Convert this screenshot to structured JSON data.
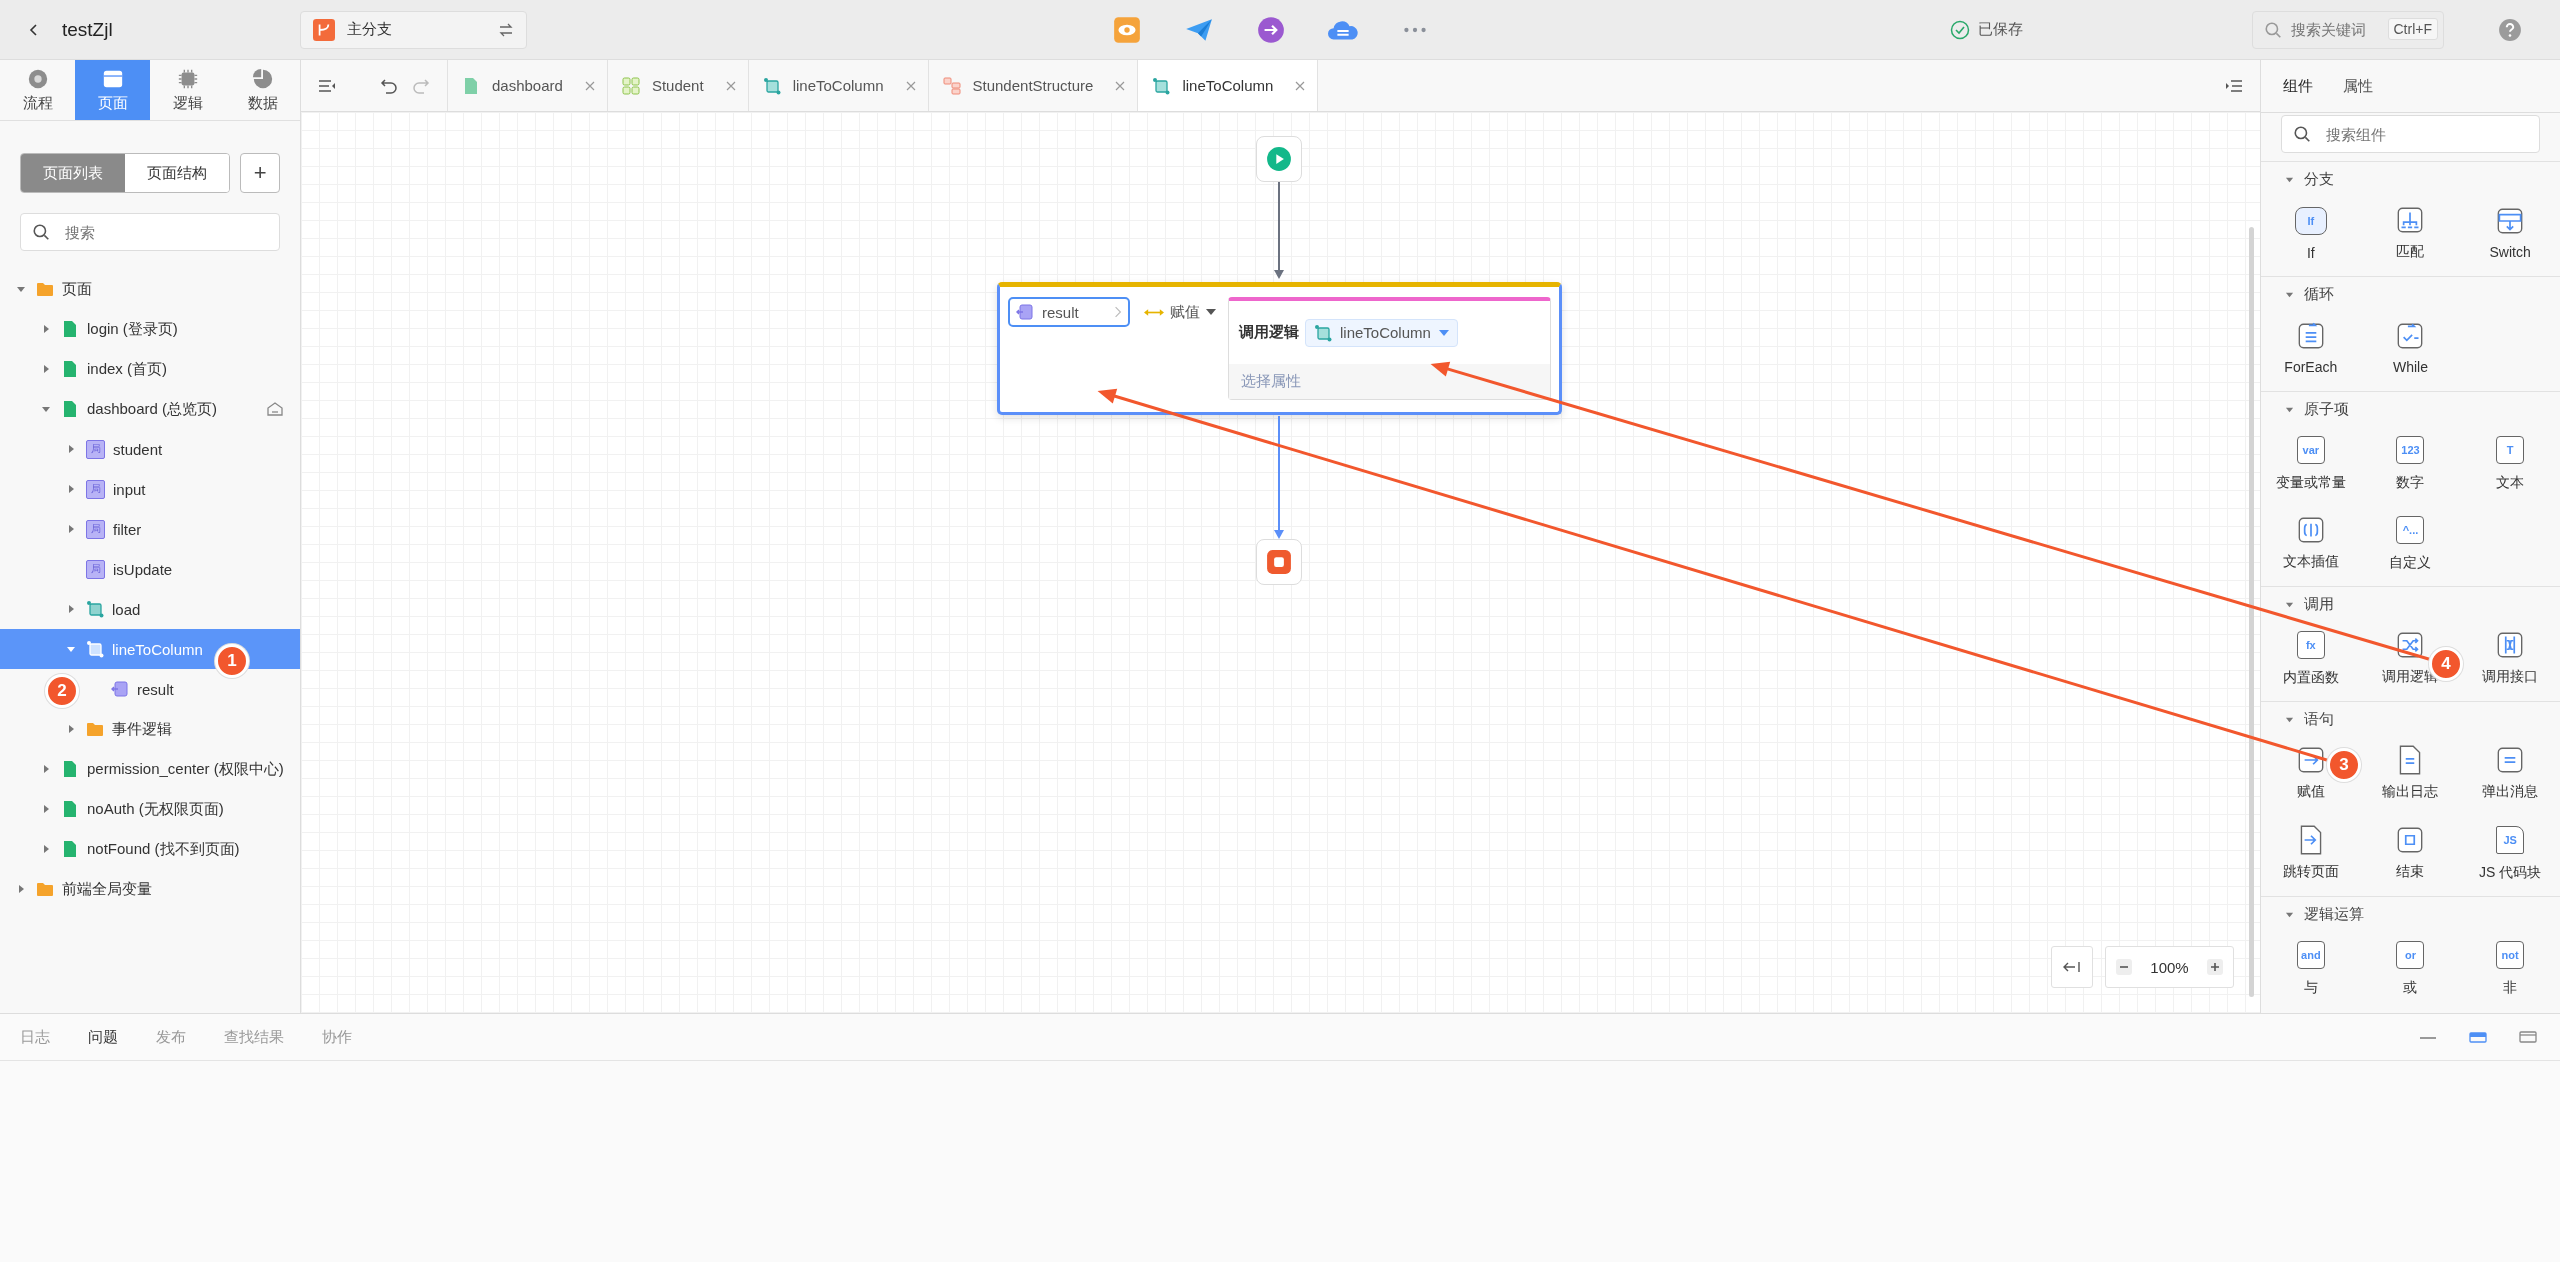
{
  "header": {
    "title": "testZjl",
    "branch": "主分支",
    "status": "已保存",
    "search": {
      "placeholder": "搜索关键词",
      "shortcut": "Ctrl+F"
    }
  },
  "rail_tabs": [
    {
      "label": "流程",
      "kind": "disc",
      "selected": false
    },
    {
      "label": "页面",
      "kind": "window",
      "selected": true
    },
    {
      "label": "逻辑",
      "kind": "chip",
      "selected": false
    },
    {
      "label": "数据",
      "kind": "pie",
      "selected": false
    }
  ],
  "view_switch": [
    {
      "label": "页面列表",
      "selected": true
    },
    {
      "label": "页面结构",
      "selected": false
    }
  ],
  "add_button": "+",
  "tree_search": {
    "placeholder": "搜索"
  },
  "tree": [
    {
      "label": "页面",
      "kind": "folder",
      "expanded": true,
      "selected": false,
      "children": [
        {
          "label": "login (登录页)",
          "kind": "page",
          "expanded": false,
          "selected": false
        },
        {
          "label": "index (首页)",
          "kind": "page",
          "expanded": false,
          "selected": false
        },
        {
          "label": "dashboard (总览页)",
          "kind": "page",
          "expanded": true,
          "selected": false,
          "home": true,
          "children": [
            {
              "label": "student",
              "kind": "variable",
              "tag": "局",
              "expanded": false,
              "selected": false
            },
            {
              "label": "input",
              "kind": "variable",
              "tag": "局",
              "expanded": false,
              "selected": false
            },
            {
              "label": "filter",
              "kind": "variable",
              "tag": "局",
              "expanded": false,
              "selected": false
            },
            {
              "label": "isUpdate",
              "kind": "variable",
              "tag": "局",
              "selected": false
            },
            {
              "label": "load",
              "kind": "logic",
              "expanded": false,
              "selected": false
            },
            {
              "label": "lineToColumn",
              "kind": "logic",
              "expanded": true,
              "selected": true,
              "children": [
                {
                  "label": "result",
                  "kind": "output",
                  "selected": false
                }
              ]
            },
            {
              "label": "事件逻辑",
              "kind": "folder",
              "expanded": false,
              "selected": false
            }
          ]
        },
        {
          "label": "permission_center (权限中心)",
          "kind": "page",
          "expanded": false,
          "selected": false
        },
        {
          "label": "noAuth (无权限页面)",
          "kind": "page",
          "expanded": false,
          "selected": false
        },
        {
          "label": "notFound (找不到页面)",
          "kind": "page",
          "expanded": false,
          "selected": false
        }
      ]
    },
    {
      "label": "前端全局变量",
      "kind": "folder",
      "expanded": false,
      "selected": false
    }
  ],
  "editor_tabs": [
    {
      "label": "dashboard",
      "kind": "page",
      "selected": false
    },
    {
      "label": "Student",
      "kind": "entity",
      "selected": false
    },
    {
      "label": "lineToColumn",
      "kind": "logic",
      "selected": false
    },
    {
      "label": "StundentStructure",
      "kind": "structure",
      "selected": false
    },
    {
      "label": "lineToColumn",
      "kind": "logic",
      "selected": true
    }
  ],
  "canvas": {
    "assign": {
      "target": "result",
      "operator": "赋值",
      "call_label": "调用逻辑",
      "call_value": "lineToColumn",
      "property_placeholder": "选择属性"
    },
    "zoom": "100%"
  },
  "right_tabs": [
    {
      "label": "组件",
      "selected": true
    },
    {
      "label": "属性",
      "selected": false
    }
  ],
  "component_search": {
    "placeholder": "搜索组件"
  },
  "component_groups": [
    {
      "title": "分支",
      "expanded": true,
      "items": [
        {
          "label": "If",
          "kind": "if",
          "glyph": "If"
        },
        {
          "label": "匹配",
          "kind": "match"
        },
        {
          "label": "Switch",
          "kind": "switch"
        }
      ]
    },
    {
      "title": "循环",
      "expanded": true,
      "items": [
        {
          "label": "ForEach",
          "kind": "foreach"
        },
        {
          "label": "While",
          "kind": "while"
        }
      ]
    },
    {
      "title": "原子项",
      "expanded": true,
      "items": [
        {
          "label": "变量或常量",
          "kind": "box",
          "glyph": "var"
        },
        {
          "label": "数字",
          "kind": "box",
          "glyph": "123"
        },
        {
          "label": "文本",
          "kind": "box",
          "glyph": "T"
        },
        {
          "label": "文本插值",
          "kind": "interp"
        },
        {
          "label": "自定义",
          "kind": "box",
          "glyph": "^..."
        }
      ]
    },
    {
      "title": "调用",
      "expanded": true,
      "items": [
        {
          "label": "内置函数",
          "kind": "box",
          "glyph": "fx"
        },
        {
          "label": "调用逻辑",
          "kind": "shuffle"
        },
        {
          "label": "调用接口",
          "kind": "api"
        }
      ]
    },
    {
      "title": "语句",
      "expanded": true,
      "items": [
        {
          "label": "赋值",
          "kind": "assign"
        },
        {
          "label": "输出日志",
          "kind": "doc"
        },
        {
          "label": "弹出消息",
          "kind": "message"
        },
        {
          "label": "跳转页面",
          "kind": "jump"
        },
        {
          "label": "结束",
          "kind": "end"
        },
        {
          "label": "JS 代码块",
          "kind": "jsdoc",
          "glyph": "JS"
        }
      ]
    },
    {
      "title": "逻辑运算",
      "expanded": true,
      "items": [
        {
          "label": "与",
          "kind": "box",
          "glyph": "and"
        },
        {
          "label": "或",
          "kind": "box",
          "glyph": "or"
        },
        {
          "label": "非",
          "kind": "box",
          "glyph": "not"
        }
      ]
    }
  ],
  "bottom_tabs": [
    {
      "label": "日志",
      "selected": false
    },
    {
      "label": "问题",
      "selected": true
    },
    {
      "label": "发布",
      "selected": false
    },
    {
      "label": "查找结果",
      "selected": false
    },
    {
      "label": "协作",
      "selected": false
    }
  ],
  "layout_buttons": [
    {
      "kind": "minimize",
      "selected": false
    },
    {
      "kind": "half",
      "selected": true
    },
    {
      "kind": "full",
      "selected": false
    }
  ],
  "annotations": [
    {
      "number": "1"
    },
    {
      "number": "2"
    },
    {
      "number": "3"
    },
    {
      "number": "4"
    }
  ]
}
